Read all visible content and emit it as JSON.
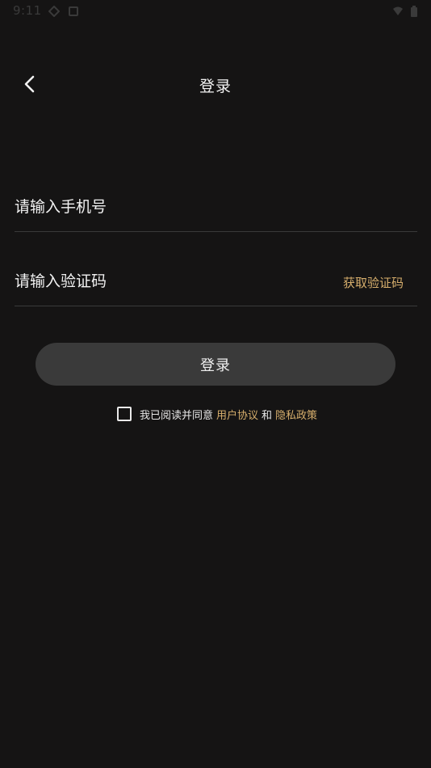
{
  "status_bar": {
    "time": "9:11",
    "icons": [
      "gear-icon",
      "shield-icon",
      "wifi-icon",
      "battery-icon"
    ]
  },
  "header": {
    "title": "登录",
    "back_icon": "chevron-left-icon"
  },
  "form": {
    "phone": {
      "placeholder": "请输入手机号",
      "value": ""
    },
    "code": {
      "placeholder": "请输入验证码",
      "value": "",
      "get_code_label": "获取验证码"
    },
    "login_label": "登录"
  },
  "agreement": {
    "checked": false,
    "prefix": "我已阅读并同意",
    "user_agreement": "用户协议",
    "conjunction": "和",
    "privacy_policy": "隐私政策"
  },
  "colors": {
    "background": "#151414",
    "accent": "#d6ae6c",
    "button_bg": "#3a3a3a",
    "divider": "#3a3a3a"
  }
}
